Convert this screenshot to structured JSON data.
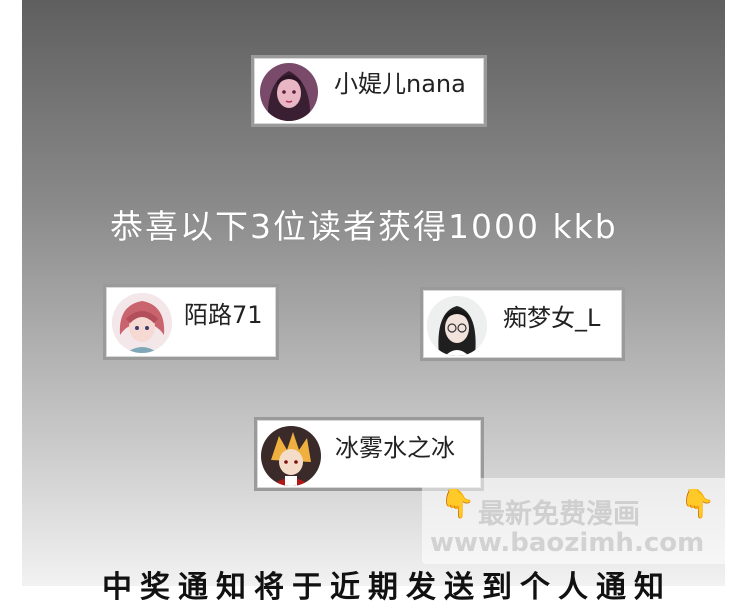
{
  "winners_top": {
    "name": "小媞儿nana"
  },
  "headline": "恭喜以下3位读者获得1000 kkb",
  "winners": [
    {
      "name": "陌路71"
    },
    {
      "name": "痴梦女_L"
    },
    {
      "name": "冰雾水之冰"
    }
  ],
  "watermark": {
    "title": "最新免费漫画",
    "url": "www.baozimh.com"
  },
  "bottom_text": "中奖通知将于近期发送到个人通知",
  "colors": {
    "panel_top": "#5f5f5f",
    "panel_bottom": "#f2f2f2",
    "card_border": "#9a9a9a"
  }
}
